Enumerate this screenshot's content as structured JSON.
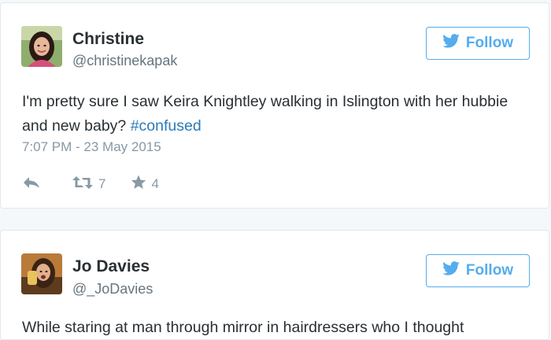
{
  "tweets": [
    {
      "name": "Christine",
      "handle": "@christinekapak",
      "follow_label": "Follow",
      "text_before": "I'm pretty sure I saw Keira Knightley walking in Islington with her hubbie and new baby? ",
      "hashtag": "#confused",
      "timestamp": "7:07 PM - 23 May 2015",
      "retweets": "7",
      "favorites": "4"
    },
    {
      "name": "Jo Davies",
      "handle": "@_JoDavies",
      "follow_label": "Follow",
      "text_before": "While staring at man through mirror in hairdressers who I thought"
    }
  ],
  "colors": {
    "accent": "#55acee",
    "hashtag": "#2b7bb9",
    "muted": "#8899a6"
  },
  "icons": [
    "bird-icon",
    "reply-icon",
    "retweet-icon",
    "star-icon"
  ]
}
